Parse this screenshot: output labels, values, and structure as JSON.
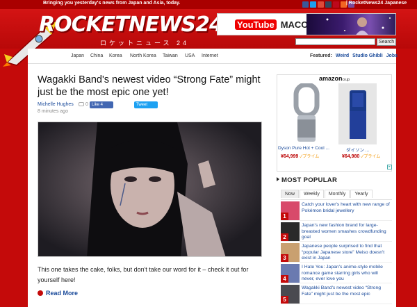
{
  "topbar": {
    "tagline": "Bringing you yesterday's news from Japan and Asia, today.",
    "links": "| RocketNews24 Japanese"
  },
  "header": {
    "logo": "ROCKETNEWS24",
    "logo_sub": "ロケットニュース 24",
    "ad_text": "MACO",
    "ad_brand": "YouTube",
    "search_placeholder": "",
    "search_button": "Search"
  },
  "nav": {
    "items": [
      "Japan",
      "China",
      "Korea",
      "North Korea",
      "Taiwan",
      "USA",
      "Internet"
    ],
    "featured_label": "Featured:",
    "featured_items": [
      "Weird",
      "Studio Ghibli",
      "Jobs"
    ]
  },
  "article": {
    "title": "Wagakki Band's newest video “Strong Fate” might just be the most epic one yet!",
    "author": "Michelle Hughes",
    "comments": "0",
    "like_label": "Like 4",
    "tweet_label": "Tweet",
    "time_ago": "8 minutes ago",
    "excerpt": "This one takes the cake, folks, but don't take our word for it – check it out for yourself here!",
    "read_more": "Read More"
  },
  "ad": {
    "brand": "amazon",
    "brand_suffix": "co.jp",
    "products": [
      {
        "name": "Dyson Pure Hot + Cool ...",
        "price": "¥64,999",
        "prime": "✓プライム"
      },
      {
        "name": "ダイソン ...",
        "price": "¥64,980",
        "prime": "✓プライム"
      }
    ]
  },
  "most_popular": {
    "heading": "MOST POPULAR",
    "tabs": [
      "Now",
      "Weekly",
      "Monthly",
      "Yearly"
    ],
    "items": [
      {
        "num": "1",
        "text": "Catch your lover's heart with new range of Pokémon bridal jewellery",
        "color": "#d84a6a"
      },
      {
        "num": "2",
        "text": "Japan's new fashion brand for large-breasted women smashes crowdfunding goal",
        "color": "#2a2a2a"
      },
      {
        "num": "3",
        "text": "Japanese people surprised to find that “popular Japanese store” Meiso doesn't exist in Japan",
        "color": "#c9a070"
      },
      {
        "num": "4",
        "text": "I Hate You: Japan's anime-style mobile romance game starring girls who will never, ever love you",
        "color": "#6a7ab0"
      },
      {
        "num": "5",
        "text": "Wagakki Band's newest video “Strong Fate” might just be the most epic",
        "color": "#4a4a50"
      }
    ]
  },
  "colors": {
    "brand_red": "#c40a0a",
    "link_blue": "#1a4a9a"
  }
}
